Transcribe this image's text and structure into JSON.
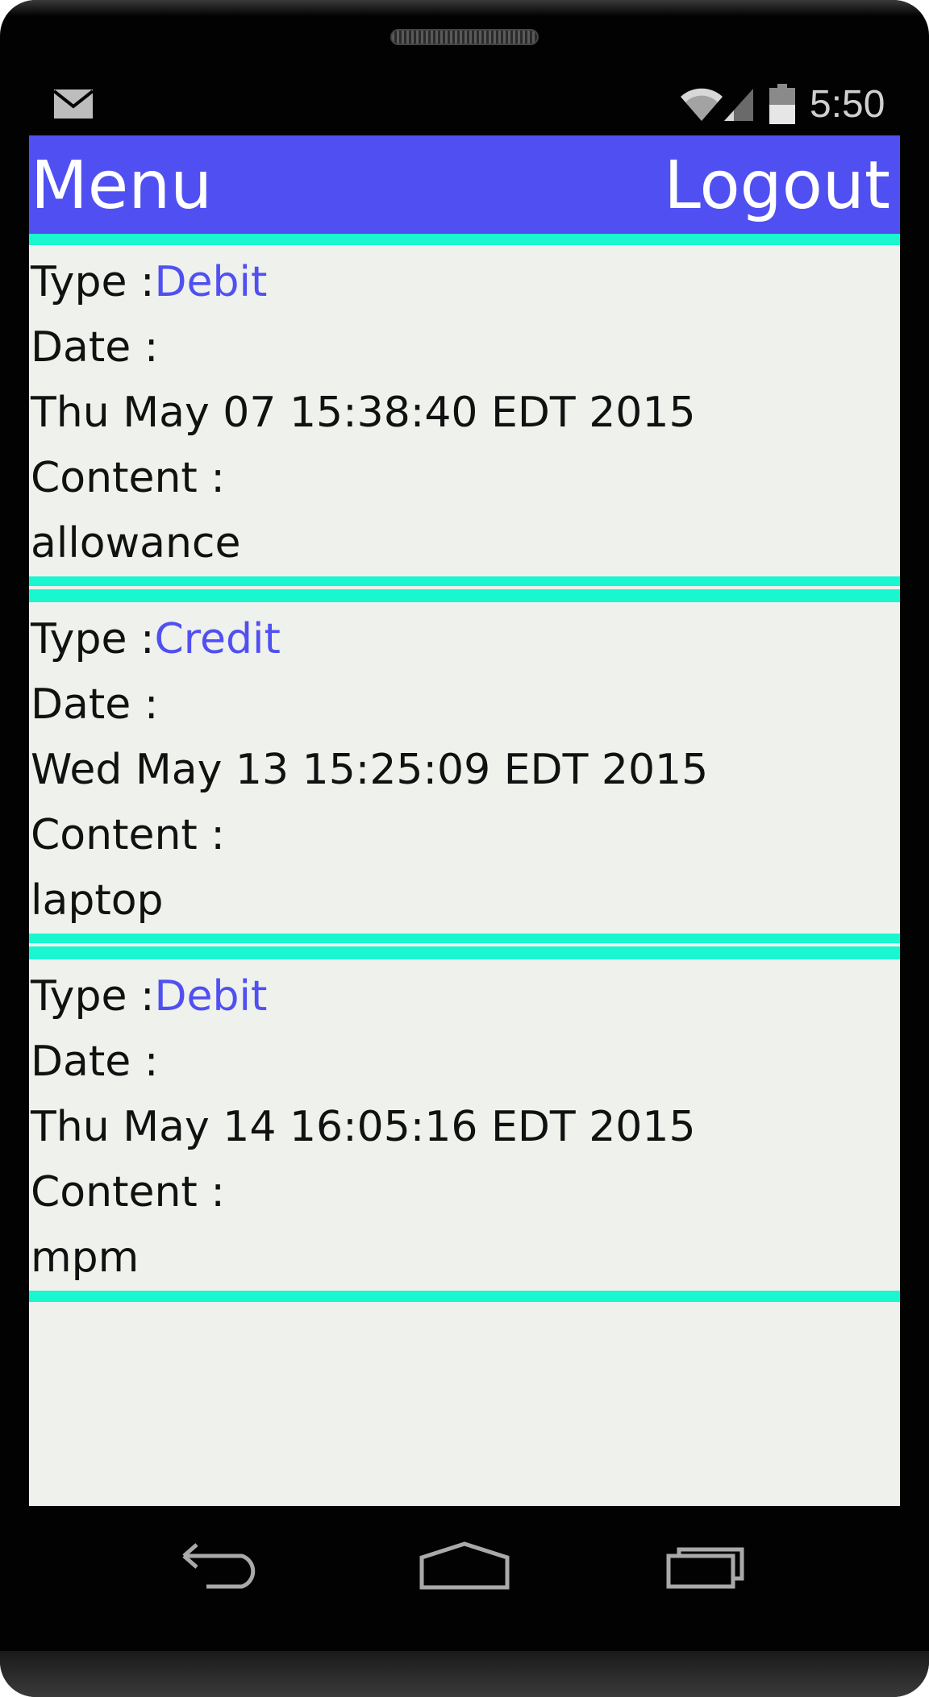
{
  "status_bar": {
    "time": "5:50",
    "icons": [
      "mail-icon",
      "wifi-icon",
      "cell-signal-icon",
      "battery-icon"
    ]
  },
  "header": {
    "menu_label": "Menu",
    "logout_label": "Logout",
    "background_color": "#5050f2",
    "divider_color": "#18f7cf"
  },
  "entries": [
    {
      "type_label": "Type :",
      "type_value": "Debit",
      "date_label": "Date :",
      "date_value": "Thu May 07 15:38:40 EDT 2015",
      "content_label": "Content :",
      "content_value": "allowance"
    },
    {
      "type_label": "Type :",
      "type_value": "Credit",
      "date_label": "Date :",
      "date_value": "Wed May 13 15:25:09 EDT 2015",
      "content_label": "Content :",
      "content_value": "laptop"
    },
    {
      "type_label": "Type :",
      "type_value": "Debit",
      "date_label": "Date :",
      "date_value": "Thu May 14 16:05:16 EDT 2015",
      "content_label": "Content :",
      "content_value": "mpm"
    }
  ],
  "nav_bar": {
    "icons": [
      "back-icon",
      "home-icon",
      "recents-icon"
    ]
  }
}
